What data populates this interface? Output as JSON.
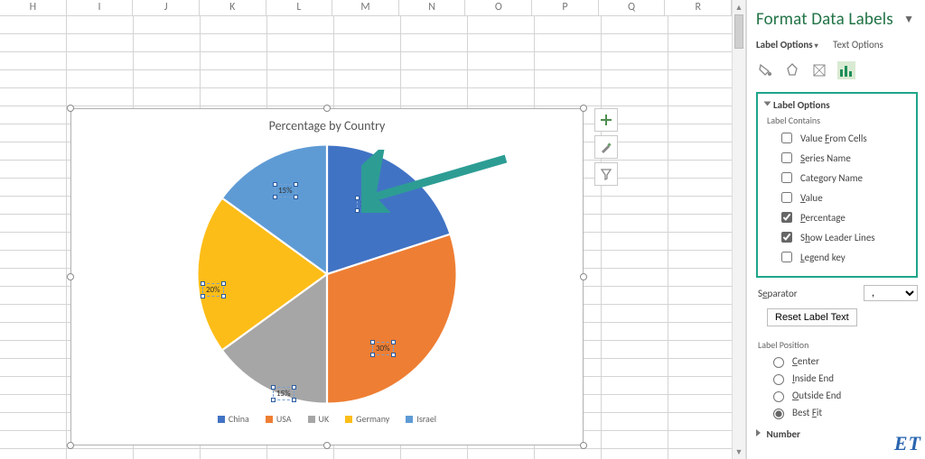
{
  "columns": [
    "H",
    "I",
    "J",
    "K",
    "L",
    "M",
    "N",
    "O",
    "P",
    "Q",
    "R"
  ],
  "chart": {
    "title": "Percentage by Country",
    "legend": [
      "China",
      "USA",
      "UK",
      "Germany",
      "Israel"
    ]
  },
  "chart_data": {
    "type": "pie",
    "title": "Percentage by Country",
    "series": [
      {
        "name": "China",
        "value": 20,
        "label": "20%",
        "color": "#4173c4"
      },
      {
        "name": "USA",
        "value": 30,
        "label": "30%",
        "color": "#ee7e33"
      },
      {
        "name": "UK",
        "value": 15,
        "label": "15%",
        "color": "#a6a6a6"
      },
      {
        "name": "Germany",
        "value": 20,
        "label": "20%",
        "color": "#fdbd18"
      },
      {
        "name": "Israel",
        "value": 15,
        "label": "15%",
        "color": "#5e9bd5"
      }
    ]
  },
  "pane": {
    "title": "Format Data Labels",
    "tab_label_options": "Label Options",
    "tab_text_options": "Text Options",
    "section_label_options": "Label Options",
    "label_contains_title": "Label Contains",
    "opt_value_from_cells": "Value From Cells",
    "opt_series_name": "Series Name",
    "opt_category_name": "Category Name",
    "opt_value": "Value",
    "opt_percentage": "Percentage",
    "opt_show_leader_lines": "Show Leader Lines",
    "opt_legend_key": "Legend key",
    "separator_label": "Separator",
    "separator_value": ",",
    "reset_label_text": "Reset Label Text",
    "label_position_title": "Label Position",
    "pos_center": "Center",
    "pos_inside_end": "Inside End",
    "pos_outside_end": "Outside End",
    "pos_best_fit": "Best Fit",
    "section_number": "Number"
  },
  "watermark": "ET"
}
